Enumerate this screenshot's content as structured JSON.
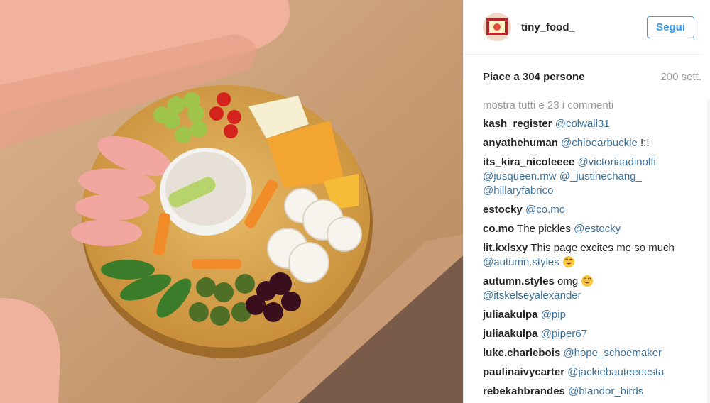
{
  "post": {
    "username": "tiny_food_",
    "follow_label": "Segui",
    "likes_text": "Piace a 304 persone",
    "time": "200 sett.",
    "show_all": "mostra tutti e 23 i commenti"
  },
  "comments": [
    {
      "user": "kash_register",
      "text": "",
      "mentions": "@colwall31"
    },
    {
      "user": "anyathehuman",
      "text": "",
      "mentions": "@chloearbuckle",
      "suffix": " !:!"
    },
    {
      "user": "its_kira_nicoleeee",
      "text": "",
      "mentions": "@victoriaadinolfi @jusqueen.mw @_justinechang_ @hillaryfabrico"
    },
    {
      "user": "estocky",
      "text": "",
      "mentions": "@co.mo"
    },
    {
      "user": "co.mo",
      "text": "The pickles ",
      "mentions": "@estocky"
    },
    {
      "user": "lit.kxlsxy",
      "text": "This page excites me so much ",
      "mentions": "@autumn.styles",
      "emoji": "laughing"
    },
    {
      "user": "autumn.styles",
      "text": "omg ",
      "emoji_inline": "laughing",
      "mentions": "@itskelseyalexander"
    },
    {
      "user": "juliaakulpa",
      "text": "",
      "mentions": "@pip"
    },
    {
      "user": "juliaakulpa",
      "text": "",
      "mentions": "@piper67"
    },
    {
      "user": "luke.charlebois",
      "text": "",
      "mentions": "@hope_schoemaker"
    },
    {
      "user": "paulinaivycarter",
      "text": "",
      "mentions": "@jackiebauteeeesta"
    },
    {
      "user": "rebekahbrandes",
      "text": "",
      "mentions": "@blandor_birds"
    }
  ],
  "colors": {
    "accent": "#3897f0",
    "mention": "#3f729b",
    "muted": "#999999"
  },
  "icons": {
    "avatar": "avatar-image",
    "emoji": "face-with-tears-of-joy-icon"
  }
}
